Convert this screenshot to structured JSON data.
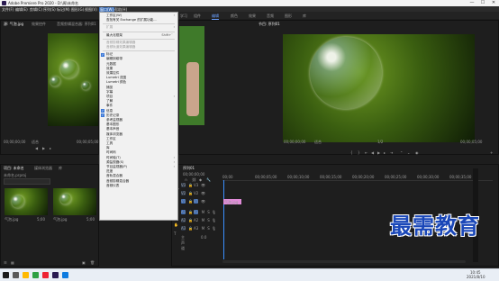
{
  "window": {
    "title": "Adobe Premiere Pro 2020 - D:\\周\\未命名",
    "minimize": "—",
    "maximize": "☐",
    "close": "✕"
  },
  "menubar": [
    "文件(F)",
    "编辑(E)",
    "剪辑(C)",
    "序列(S)",
    "标记(M)",
    "图形(G)",
    "视图(V)",
    "窗口(W)",
    "帮助(H)"
  ],
  "menubar_active": "窗口(W)",
  "workspaces": [
    "学习",
    "组件",
    "编辑",
    "颜色",
    "效果",
    "音频",
    "图形",
    "库"
  ],
  "workspace_active": "编辑",
  "source_panel": {
    "tabs": [
      "源: 气泡.jpg",
      "效果控件",
      "音频剪辑混合器: 序列01",
      "元数据"
    ],
    "timecode_left": "00;00;00;00",
    "fit": "适合",
    "page": "1/2",
    "timecode_right": "00;00;05;00"
  },
  "program_panel": {
    "tab": "节目: 序列01",
    "timecode_left": "00;00;00;00",
    "fit": "适合",
    "page": "1/2",
    "timecode_right": "00;00;05;00"
  },
  "project_panel": {
    "tabs": [
      "项目: 未命名",
      "媒体浏览器",
      "库"
    ],
    "file": "未命名.prproj",
    "items": [
      {
        "name": "气泡.jpg",
        "duration": "5;00"
      },
      {
        "name": "气泡.jpg",
        "duration": "5;00"
      }
    ]
  },
  "timeline": {
    "tab": "序列01",
    "timecode": "00;00;00;00",
    "ruler": [
      "00;00",
      "00;00;05;00",
      "00;00;10;00",
      "00;00;15;00",
      "00;00;20;00",
      "00;00;25;00",
      "00;00;30;00",
      "00;00;35;00"
    ],
    "tracks": [
      {
        "id": "V3",
        "type": "video"
      },
      {
        "id": "V2",
        "type": "video"
      },
      {
        "id": "V1",
        "type": "video"
      },
      {
        "id": "A1",
        "type": "audio"
      },
      {
        "id": "A2",
        "type": "audio"
      },
      {
        "id": "A3",
        "type": "audio"
      }
    ],
    "master": "主声道",
    "master_value": "0.0",
    "clip": "气泡.jpg"
  },
  "window_menu": {
    "items": [
      {
        "label": "工作区(W)",
        "submenu": true,
        "checked": false,
        "disabled": false
      },
      {
        "label": "查找有关 Exchange 的扩展功能...",
        "checked": false,
        "disabled": false
      },
      {
        "sep": true
      },
      {
        "label": "扩展",
        "submenu": true,
        "checked": false,
        "disabled": true
      },
      {
        "sep": true
      },
      {
        "label": "最大化框架",
        "shortcut": "Shift+`",
        "checked": false,
        "disabled": false
      },
      {
        "sep": true
      },
      {
        "label": "音频剪辑效果编辑器",
        "checked": false,
        "disabled": true
      },
      {
        "label": "音频轨道效果编辑器",
        "checked": false,
        "disabled": true
      },
      {
        "sep": true
      },
      {
        "label": "标记",
        "checked": true,
        "disabled": false
      },
      {
        "label": "编辑到磁带",
        "checked": false,
        "disabled": false
      },
      {
        "label": "元数据",
        "checked": false,
        "disabled": false
      },
      {
        "label": "效果",
        "checked": false,
        "disabled": false
      },
      {
        "label": "效果控件",
        "checked": false,
        "disabled": false
      },
      {
        "label": "Lumetri 范围",
        "checked": false,
        "disabled": false
      },
      {
        "label": "Lumetri 颜色",
        "checked": false,
        "disabled": false
      },
      {
        "label": "捕捉",
        "checked": false,
        "disabled": false
      },
      {
        "label": "字幕",
        "checked": false,
        "disabled": false
      },
      {
        "label": "项目",
        "submenu": true,
        "checked": false,
        "disabled": false
      },
      {
        "label": "了解",
        "checked": false,
        "disabled": false
      },
      {
        "label": "事件",
        "checked": false,
        "disabled": false
      },
      {
        "label": "信息",
        "checked": true,
        "disabled": false
      },
      {
        "label": "历史记录",
        "checked": true,
        "disabled": false
      },
      {
        "label": "参考监视器",
        "checked": false,
        "disabled": false
      },
      {
        "label": "基本图形",
        "checked": false,
        "disabled": false
      },
      {
        "label": "基本声音",
        "checked": false,
        "disabled": false
      },
      {
        "label": "媒体浏览器",
        "checked": false,
        "disabled": false
      },
      {
        "label": "工作区",
        "checked": false,
        "disabled": false
      },
      {
        "label": "工具",
        "checked": false,
        "disabled": false
      },
      {
        "label": "库",
        "checked": false,
        "disabled": false
      },
      {
        "label": "时间码",
        "checked": false,
        "disabled": false
      },
      {
        "label": "时间轴(T)",
        "submenu": true,
        "checked": false,
        "disabled": false
      },
      {
        "label": "源监视器(S)",
        "submenu": true,
        "checked": false,
        "disabled": false
      },
      {
        "label": "节目监视器(P)",
        "submenu": true,
        "checked": false,
        "disabled": false
      },
      {
        "label": "进度",
        "checked": false,
        "disabled": false
      },
      {
        "label": "音轨混合器",
        "checked": false,
        "disabled": false
      },
      {
        "label": "音频剪辑混合器",
        "checked": false,
        "disabled": false
      },
      {
        "label": "音频仪表",
        "checked": false,
        "disabled": false
      }
    ]
  },
  "taskbar": {
    "time": "10:45",
    "date": "2021/8/10"
  },
  "watermark": "最需教育",
  "colors": {
    "menu_highlight": "#3d6fb8",
    "timecode_blue": "#3a8fff",
    "clip_pink": "#e08bd8",
    "watermark": "#1a47b8"
  }
}
